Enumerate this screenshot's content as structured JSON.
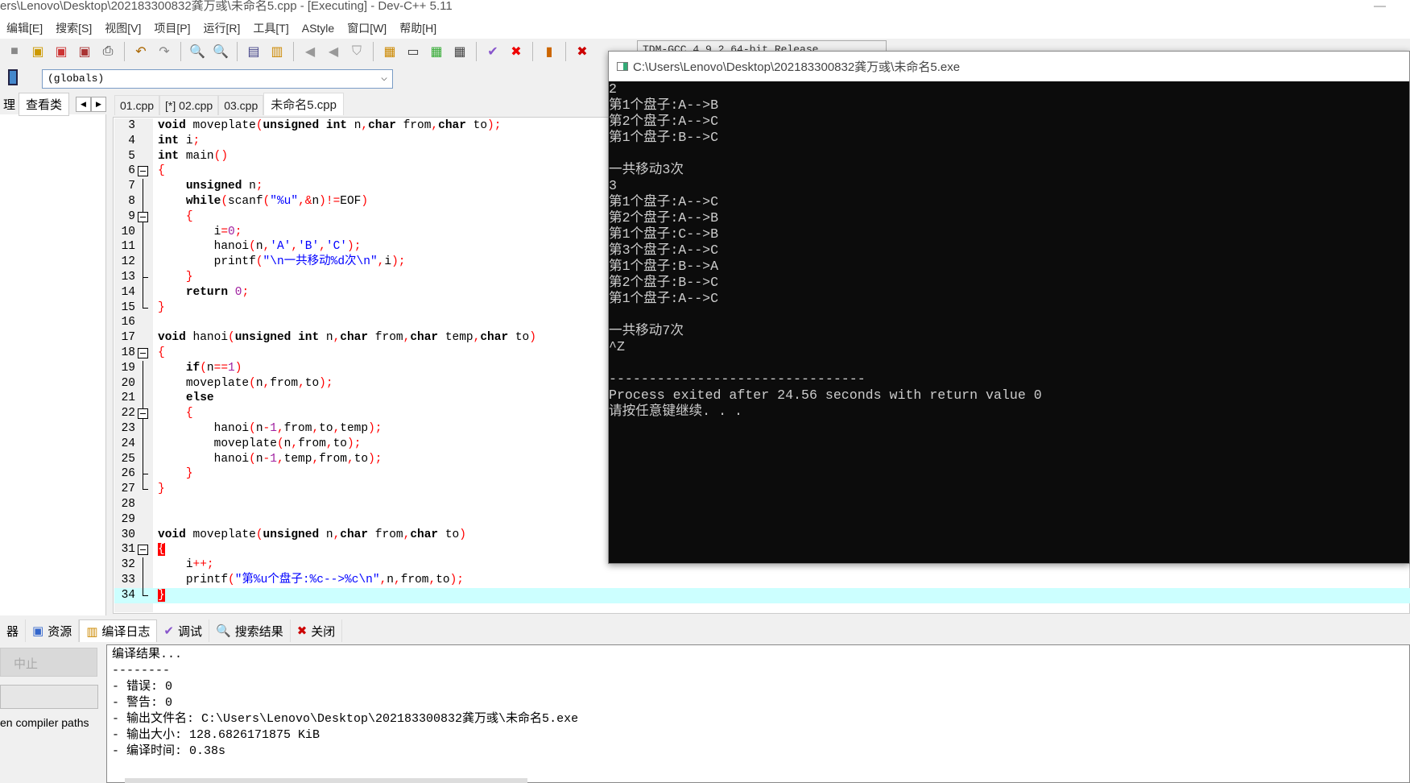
{
  "window": {
    "title": "ers\\Lenovo\\Desktop\\202183300832龚万彧\\未命名5.cpp - [Executing] - Dev-C++ 5.11",
    "minimize": "—"
  },
  "menu": [
    "编辑[E]",
    "搜索[S]",
    "视图[V]",
    "项目[P]",
    "运行[R]",
    "工具[T]",
    "AStyle",
    "窗口[W]",
    "帮助[H]"
  ],
  "toolbar": {
    "compiler": "TDM-GCC 4.9.2 64-bit Release",
    "icons": [
      "new",
      "open",
      "close",
      "close-all",
      "print",
      "undo",
      "redo",
      "find",
      "replace",
      "indent",
      "unindent",
      "bookmark-prev",
      "bookmark-next",
      "bookmark",
      "compile",
      "run",
      "compile-run",
      "rebuild",
      "syntax-check",
      "stop",
      "profile",
      "debug"
    ]
  },
  "scope": {
    "value": "(globals)"
  },
  "left_tabs": {
    "project": "理",
    "classes": "查看类",
    "prev": "◀",
    "next": "▶"
  },
  "file_tabs": [
    "01.cpp",
    "[*] 02.cpp",
    "03.cpp",
    "未命名5.cpp"
  ],
  "active_file_tab": 3,
  "editor": {
    "first_line": 3,
    "current_line": 34,
    "lines": [
      "void moveplate(unsigned int n,char from,char to);",
      "int i;",
      "int main()",
      "{",
      "    unsigned n;",
      "    while(scanf(\"%u\",&n)!=EOF)",
      "    {",
      "        i=0;",
      "        hanoi(n,'A','B','C');",
      "        printf(\"\\n一共移动%d次\\n\",i);",
      "    }",
      "    return 0;",
      "}",
      "",
      "void hanoi(unsigned int n,char from,char temp,char to)",
      "{",
      "    if(n==1)",
      "    moveplate(n,from,to);",
      "    else",
      "    {",
      "        hanoi(n-1,from,to,temp);",
      "        moveplate(n,from,to);",
      "        hanoi(n-1,temp,from,to);",
      "    }",
      "}",
      "",
      "",
      "void moveplate(unsigned n,char from,char to)",
      "{",
      "    i++;",
      "    printf(\"第%u个盘子:%c-->%c\\n\",n,from,to);",
      "}"
    ]
  },
  "console": {
    "title": "C:\\Users\\Lenovo\\Desktop\\202183300832龚万彧\\未命名5.exe",
    "lines": [
      "2",
      "第1个盘子:A-->B",
      "第2个盘子:A-->C",
      "第1个盘子:B-->C",
      "",
      "一共移动3次",
      "3",
      "第1个盘子:A-->C",
      "第2个盘子:A-->B",
      "第1个盘子:C-->B",
      "第3个盘子:A-->C",
      "第1个盘子:B-->A",
      "第2个盘子:B-->C",
      "第1个盘子:A-->C",
      "",
      "一共移动7次",
      "^Z",
      "",
      "--------------------------------",
      "Process exited after 24.56 seconds with return value 0",
      "请按任意键继续. . ."
    ]
  },
  "bottom_tabs": [
    "器",
    "资源",
    "编译日志",
    "调试",
    "搜索结果",
    "关闭"
  ],
  "bottom_active": 2,
  "bottom_left": {
    "stop": "中止",
    "paths": "en compiler paths"
  },
  "log": [
    "编译结果...",
    "--------",
    "- 错误: 0",
    "- 警告: 0",
    "- 输出文件名: C:\\Users\\Lenovo\\Desktop\\202183300832龚万彧\\未命名5.exe",
    "- 输出大小: 128.6826171875 KiB",
    "- 编译时间: 0.38s"
  ],
  "colors": {
    "keyword": "#000000",
    "punct": "#ff0000",
    "string": "#0000ff",
    "number": "#a020a0",
    "current_line": "#ccffff",
    "console_bg": "#0c0c0c"
  }
}
